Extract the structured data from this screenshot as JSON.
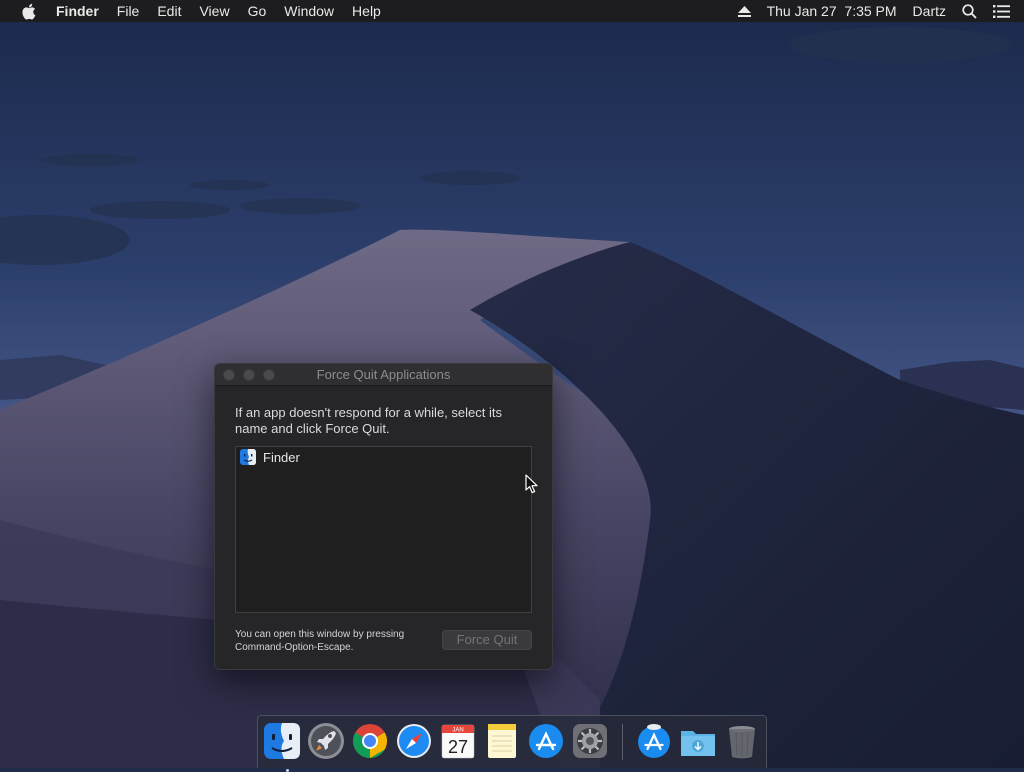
{
  "menubar": {
    "app_name": "Finder",
    "menus": [
      "File",
      "Edit",
      "View",
      "Go",
      "Window",
      "Help"
    ],
    "clock": "Thu Jan 27  7:35 PM",
    "user": "Dartz",
    "icons": [
      "apple-icon",
      "eject-icon",
      "spotlight-search-icon",
      "notification-center-icon"
    ]
  },
  "force_quit_window": {
    "title": "Force Quit Applications",
    "instructions": "If an app doesn't respond for a while, select its name and click Force Quit.",
    "apps": [
      {
        "name": "Finder",
        "icon": "finder-icon"
      }
    ],
    "hint": "You can open this window by pressing Command-Option-Escape.",
    "force_quit_label": "Force Quit",
    "force_quit_enabled": false
  },
  "dock": {
    "items": [
      {
        "name": "finder",
        "icon": "finder-icon",
        "running": true
      },
      {
        "name": "launchpad",
        "icon": "rocket-icon",
        "running": false
      },
      {
        "name": "chrome",
        "icon": "chrome-icon",
        "running": false
      },
      {
        "name": "safari",
        "icon": "compass-icon",
        "running": false
      },
      {
        "name": "calendar",
        "icon": "calendar-icon",
        "running": false,
        "month": "JAN",
        "day": "27"
      },
      {
        "name": "notes",
        "icon": "notes-icon",
        "running": false
      },
      {
        "name": "app-store",
        "icon": "app-store-icon",
        "running": false
      },
      {
        "name": "system-preferences",
        "icon": "gear-icon",
        "running": false
      },
      {
        "name": "app-store-downloads",
        "icon": "app-store-icon",
        "running": false
      },
      {
        "name": "downloads-folder",
        "icon": "folder-download-icon",
        "running": false
      },
      {
        "name": "trash",
        "icon": "trash-icon",
        "running": false
      }
    ]
  },
  "colors": {
    "menubar_bg": "#1d1d1f",
    "window_bg": "#262628",
    "list_bg": "#1f1f20",
    "finder_blue": "#1e7ae0",
    "sky_top": "#1f2c4a",
    "dune_shadow": "#1b2238"
  }
}
